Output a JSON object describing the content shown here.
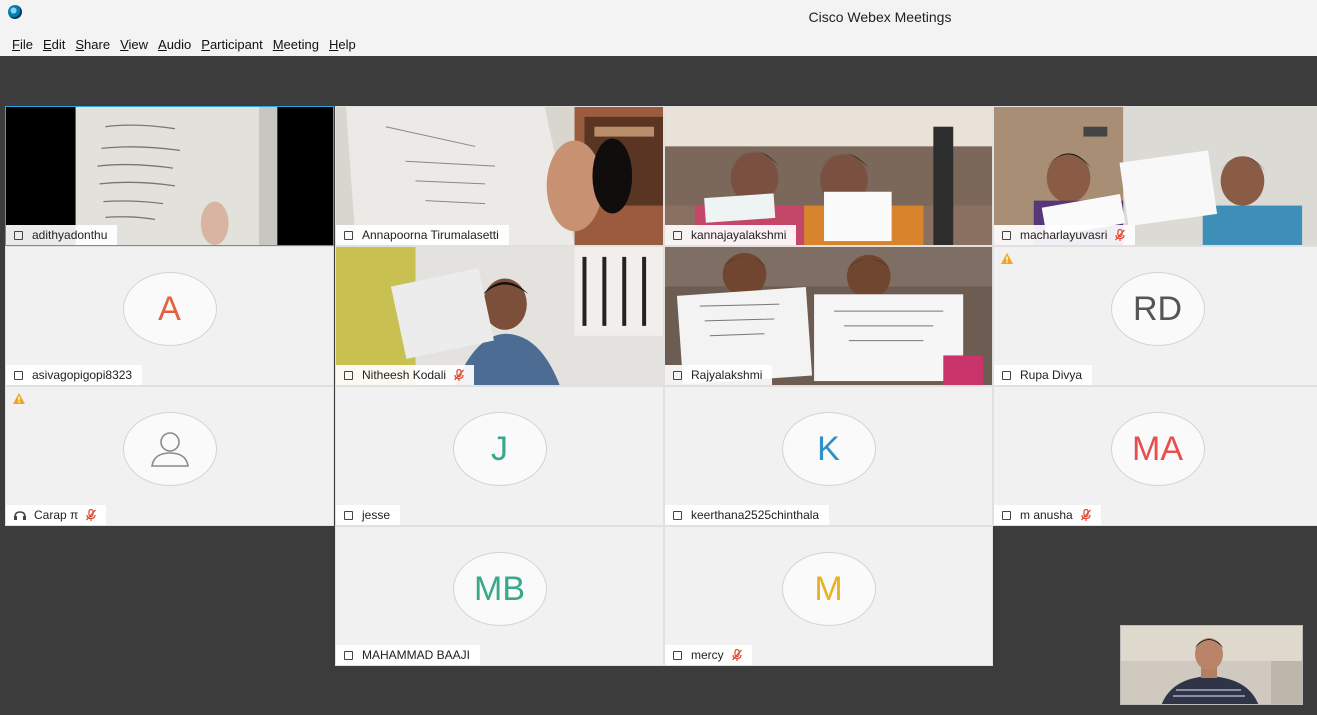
{
  "window": {
    "title": "Cisco Webex Meetings"
  },
  "menu": [
    {
      "acc": "F",
      "rest": "ile"
    },
    {
      "acc": "E",
      "rest": "dit"
    },
    {
      "acc": "S",
      "rest": "hare"
    },
    {
      "acc": "V",
      "rest": "iew"
    },
    {
      "acc": "A",
      "rest": "udio"
    },
    {
      "acc": "P",
      "rest": "articipant"
    },
    {
      "acc": "M",
      "rest": "eeting"
    },
    {
      "acc": "H",
      "rest": "elp"
    }
  ],
  "participants": [
    {
      "name": "adithyadonthu",
      "muted": false,
      "video": true,
      "active": true
    },
    {
      "name": "Annapoorna Tirumalasetti",
      "muted": false,
      "video": true
    },
    {
      "name": "kannajayalakshmi",
      "muted": false,
      "video": true
    },
    {
      "name": "macharlayuvasri",
      "muted": true,
      "video": true
    },
    {
      "name": "asivagopigopi8323",
      "muted": false,
      "initials": "A",
      "color": "#e2623f"
    },
    {
      "name": "Nitheesh Kodali",
      "muted": true,
      "video": true
    },
    {
      "name": "Rajyalakshmi",
      "muted": false,
      "video": true
    },
    {
      "name": "Rupa Divya",
      "muted": false,
      "initials": "RD",
      "color": "#555555",
      "warning": true
    },
    {
      "name": "Carap π",
      "muted": true,
      "phone": true,
      "placeholder": true,
      "warning": true
    },
    {
      "name": "jesse",
      "muted": false,
      "initials": "J",
      "color": "#3aa88a"
    },
    {
      "name": "keerthana2525chinthala",
      "muted": false,
      "initials": "K",
      "color": "#2f8fc9"
    },
    {
      "name": "m anusha",
      "muted": true,
      "initials": "MA",
      "color": "#e64f4f"
    },
    {
      "name": "MAHAMMAD BAAJI",
      "muted": false,
      "initials": "MB",
      "color": "#3aa88a"
    },
    {
      "name": "mercy",
      "muted": true,
      "initials": "M",
      "color": "#e8b225"
    }
  ],
  "colors": {
    "accent": "#2aa6e0",
    "mute": "#e0452f",
    "warning": "#f1a420",
    "stage": "#3c3c3c"
  }
}
